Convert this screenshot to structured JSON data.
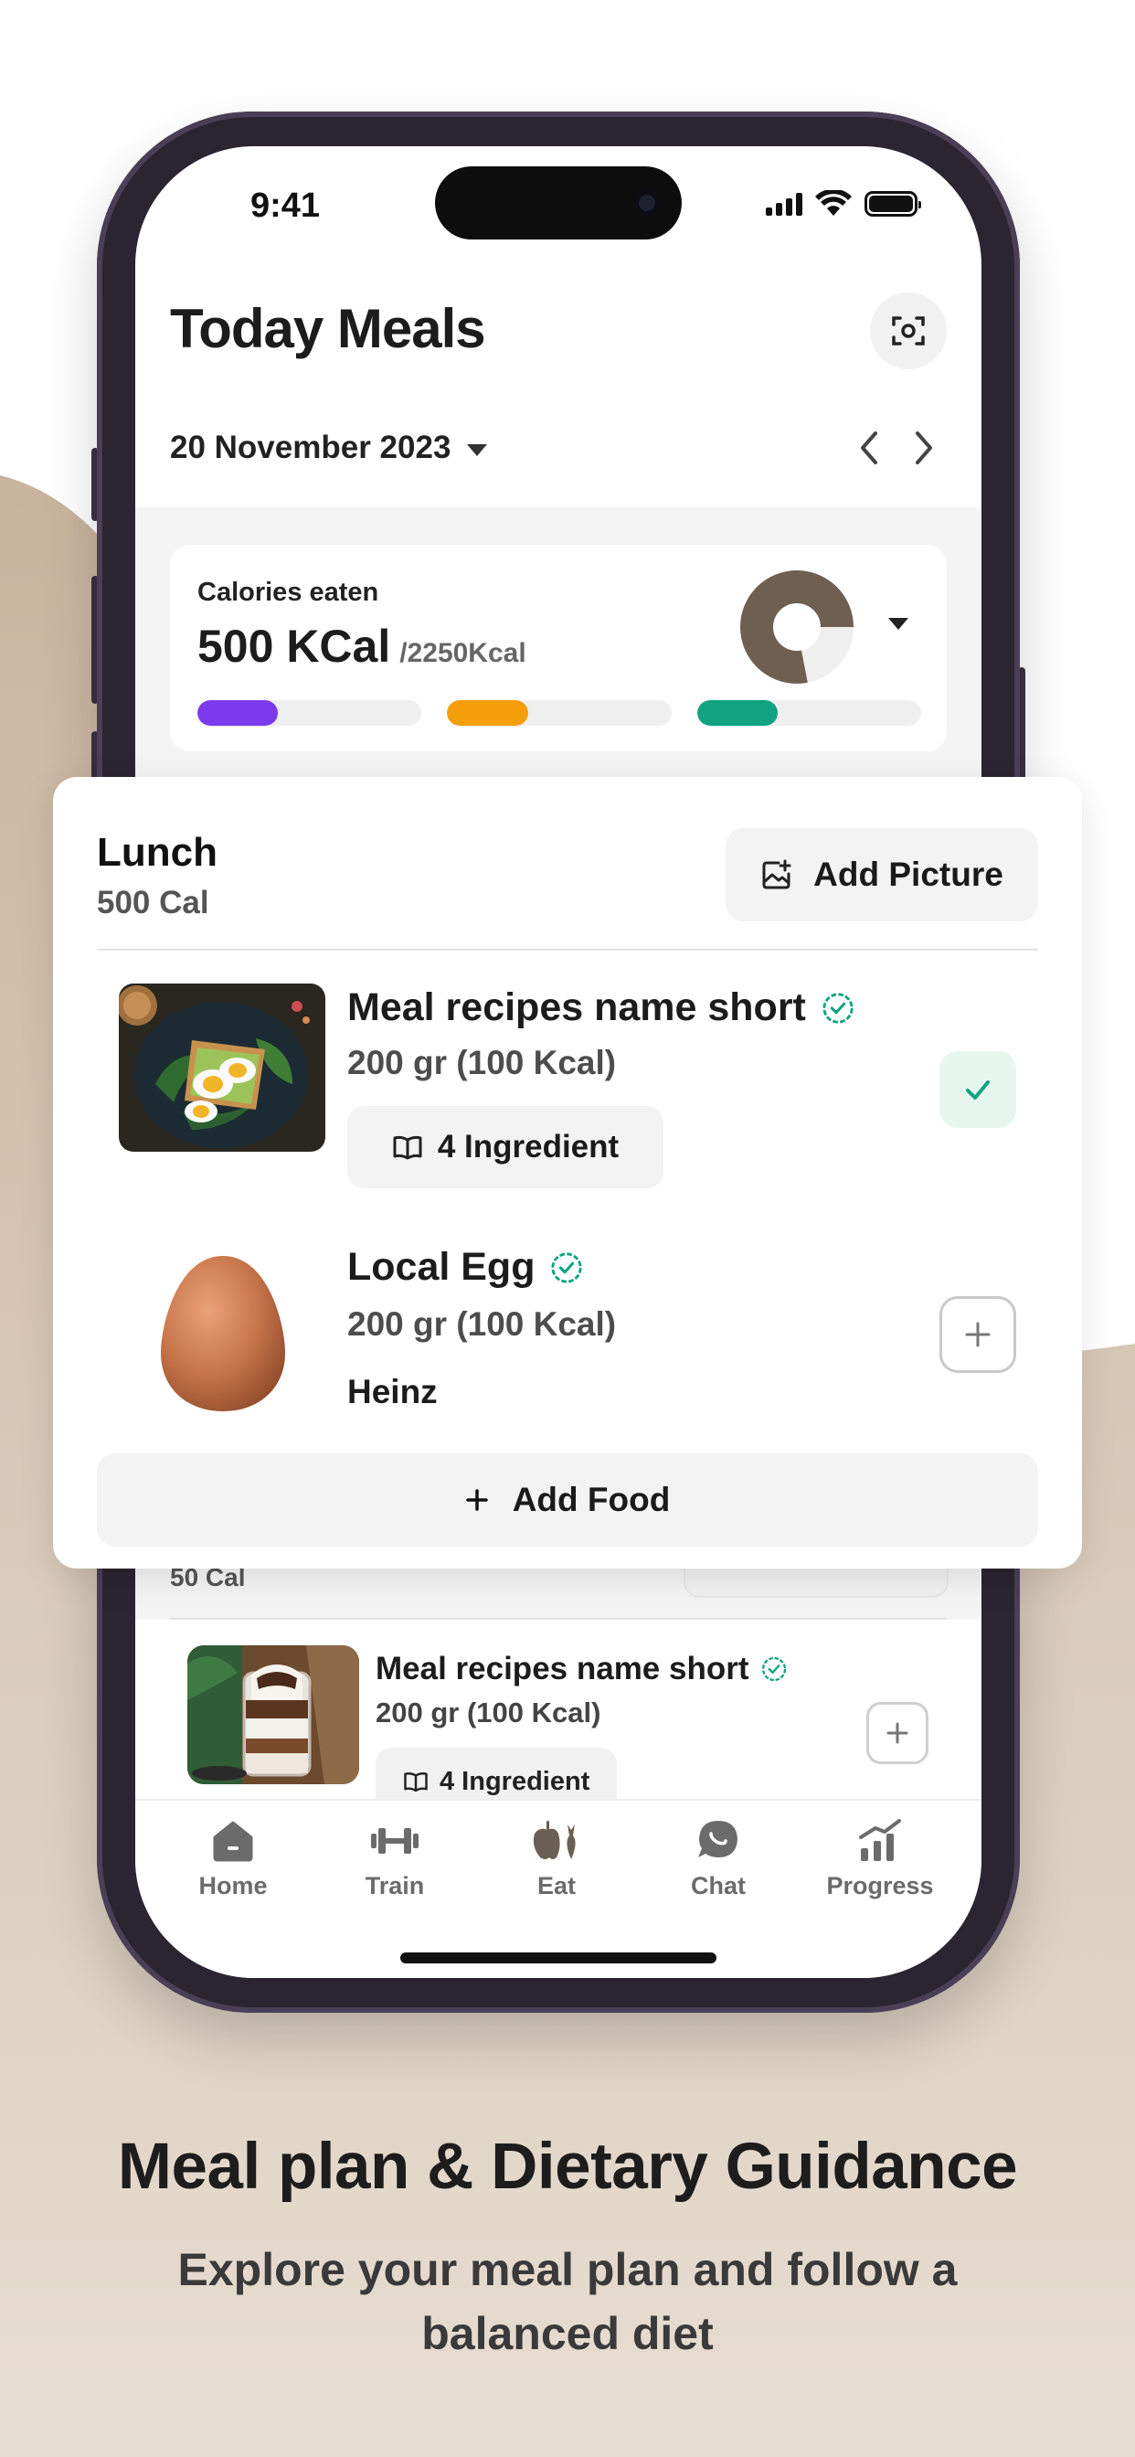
{
  "status_bar": {
    "time": "9:41"
  },
  "header": {
    "title": "Today Meals",
    "scan_icon": "scan-icon"
  },
  "date_picker": {
    "date": "20 November 2023"
  },
  "calories_card": {
    "label": "Calories eaten",
    "eaten": "500 KCal",
    "total": "/2250Kcal",
    "progress": 0.22,
    "donut_color": "#6e5f51",
    "macros": [
      {
        "color": "#7c3aed",
        "fraction": 0.36
      },
      {
        "color": "#f59e0b",
        "fraction": 0.36
      },
      {
        "color": "#10a37f",
        "fraction": 0.36
      }
    ]
  },
  "lunch": {
    "title": "Lunch",
    "calories": "500 Cal",
    "add_picture_label": "Add Picture",
    "items": [
      {
        "name": "Meal recipes name short",
        "amount": "200 gr (100 Kcal)",
        "ingredients_label": "4 Ingredient",
        "added": true
      },
      {
        "name": "Local Egg",
        "amount": "200 gr (100 Kcal)",
        "brand": "Heinz",
        "added": false
      }
    ],
    "add_food_label": "Add Food"
  },
  "snack": {
    "calories": "50 Cal",
    "item": {
      "name": "Meal recipes name short",
      "amount": "200 gr (100 Kcal)",
      "ingredients_label": "4 Ingredient"
    }
  },
  "tabs": [
    {
      "label": "Home",
      "icon": "home-icon"
    },
    {
      "label": "Train",
      "icon": "dumbbell-icon"
    },
    {
      "label": "Eat",
      "icon": "food-icon"
    },
    {
      "label": "Chat",
      "icon": "chat-icon"
    },
    {
      "label": "Progress",
      "icon": "progress-icon"
    }
  ],
  "marketing": {
    "headline": "Meal plan & Dietary Guidance",
    "subheadline": "Explore your meal plan and follow a balanced diet"
  },
  "colors": {
    "accent_green": "#10a37f",
    "beige": "#d6c6b4",
    "phone_frame": "#2b2431"
  }
}
